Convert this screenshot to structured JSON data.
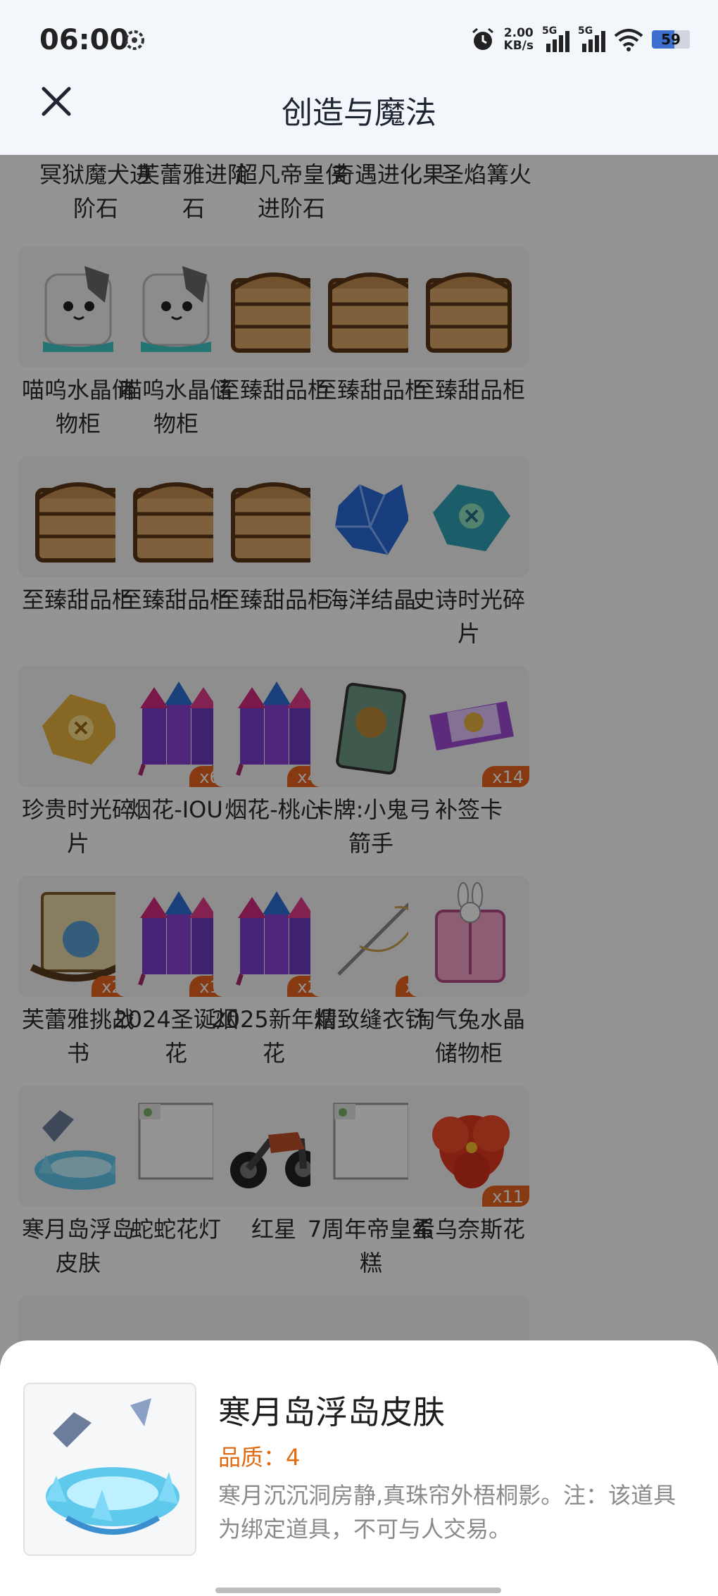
{
  "status_bar": {
    "time": "06:00",
    "net_speed_value": "2.00",
    "net_speed_unit": "KB/s",
    "signal1_tag": "5G",
    "signal2_tag": "5G",
    "battery": "59"
  },
  "header": {
    "title": "创造与魔法"
  },
  "top_row": [
    {
      "name": "冥狱魔犬进阶石"
    },
    {
      "name": "芙蕾雅进阶石"
    },
    {
      "name": "超凡帝皇侠进阶石"
    },
    {
      "name": "奇遇进化果"
    },
    {
      "name": "圣焰篝火"
    }
  ],
  "items": [
    {
      "name": "喵呜水晶储物柜",
      "icon": "crystal-cabinet-icon",
      "count": ""
    },
    {
      "name": "喵呜水晶储物柜",
      "icon": "crystal-cabinet-icon",
      "count": ""
    },
    {
      "name": "至臻甜品柜",
      "icon": "dessert-cabinet-icon",
      "count": ""
    },
    {
      "name": "至臻甜品柜",
      "icon": "dessert-cabinet-icon",
      "count": ""
    },
    {
      "name": "至臻甜品柜",
      "icon": "dessert-cabinet-icon",
      "count": ""
    },
    {
      "name": "至臻甜品柜",
      "icon": "dessert-cabinet-icon",
      "count": ""
    },
    {
      "name": "至臻甜品柜",
      "icon": "dessert-cabinet-icon",
      "count": ""
    },
    {
      "name": "至臻甜品柜",
      "icon": "dessert-cabinet-icon",
      "count": ""
    },
    {
      "name": "海洋结晶",
      "icon": "ocean-crystal-icon",
      "count": ""
    },
    {
      "name": "史诗时光碎片",
      "icon": "epic-time-shard-icon",
      "count": ""
    },
    {
      "name": "珍贵时光碎片",
      "icon": "precious-time-shard-icon",
      "count": ""
    },
    {
      "name": "烟花-IOU",
      "icon": "firework-icon",
      "count": "x65"
    },
    {
      "name": "烟花-桃心",
      "icon": "firework-icon",
      "count": "x45"
    },
    {
      "name": "卡牌:小鬼弓箭手",
      "icon": "card-icon",
      "count": ""
    },
    {
      "name": "补签卡",
      "icon": "ticket-icon",
      "count": "x14"
    },
    {
      "name": "芙蕾雅挑战书",
      "icon": "wanted-scroll-icon",
      "count": "x24"
    },
    {
      "name": "2024圣诞烟花",
      "icon": "firework-icon",
      "count": "x15"
    },
    {
      "name": "2025新年烟花",
      "icon": "firework-icon",
      "count": "x28"
    },
    {
      "name": "精致缝衣针",
      "icon": "needle-icon",
      "count": "x4"
    },
    {
      "name": "淘气兔水晶储物柜",
      "icon": "rabbit-cabinet-icon",
      "count": ""
    },
    {
      "name": "寒月岛浮岛皮肤",
      "icon": "floating-island-icon",
      "count": ""
    },
    {
      "name": "蛇蛇花灯",
      "icon": "broken-image-icon",
      "count": ""
    },
    {
      "name": "红星",
      "icon": "motorcycle-icon",
      "count": ""
    },
    {
      "name": "7周年帝皇蛋糕",
      "icon": "broken-image-icon",
      "count": ""
    },
    {
      "name": "希乌奈斯花",
      "icon": "red-flower-icon",
      "count": "x11"
    }
  ],
  "detail": {
    "name": "寒月岛浮岛皮肤",
    "quality": "品质：4",
    "description": "寒月沉沉洞房静,真珠帘外梧桐影。注：该道具为绑定道具，不可与人交易。"
  },
  "colors": {
    "accent": "#e8631e",
    "quality": "#e06a10",
    "header_bg": "#f3f6fa"
  }
}
